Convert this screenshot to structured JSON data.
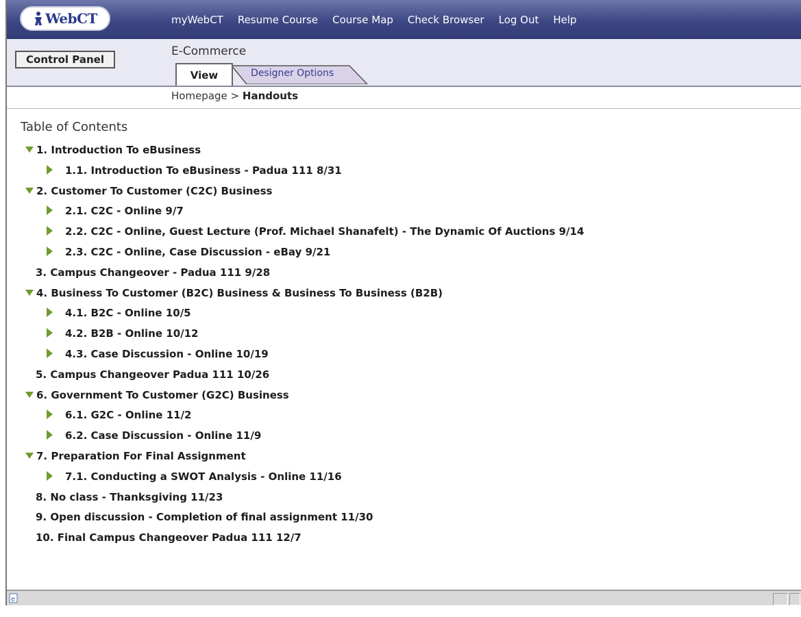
{
  "topbar": {
    "logo_text": "WebCT",
    "nav": [
      "myWebCT",
      "Resume Course",
      "Course Map",
      "Check Browser",
      "Log Out",
      "Help"
    ]
  },
  "header": {
    "control_panel": "Control Panel",
    "course_title": "E-Commerce",
    "tabs": {
      "view": "View",
      "designer": "Designer Options"
    },
    "breadcrumb": {
      "home": "Homepage",
      "separator": ">",
      "current": "Handouts"
    }
  },
  "toc": {
    "heading": "Table of Contents",
    "items": [
      {
        "level": 1,
        "expanded": true,
        "text": "1. Introduction To eBusiness"
      },
      {
        "level": 2,
        "text": "1.1. Introduction To eBusiness - Padua 111 8/31"
      },
      {
        "level": 1,
        "expanded": true,
        "text": "2. Customer To Customer (C2C) Business"
      },
      {
        "level": 2,
        "text": "2.1. C2C - Online 9/7"
      },
      {
        "level": 2,
        "text": "2.2. C2C - Online, Guest Lecture (Prof. Michael Shanafelt) - The Dynamic Of Auctions 9/14"
      },
      {
        "level": 2,
        "text": "2.3. C2C - Online, Case Discussion - eBay 9/21"
      },
      {
        "level": 1,
        "expanded": false,
        "text": "3. Campus Changeover - Padua 111 9/28"
      },
      {
        "level": 1,
        "expanded": true,
        "text": "4. Business To Customer (B2C) Business & Business To Business (B2B)"
      },
      {
        "level": 2,
        "text": "4.1. B2C - Online 10/5"
      },
      {
        "level": 2,
        "text": "4.2. B2B - Online 10/12"
      },
      {
        "level": 2,
        "text": "4.3. Case Discussion - Online 10/19"
      },
      {
        "level": 1,
        "expanded": false,
        "text": "5. Campus Changeover Padua 111 10/26"
      },
      {
        "level": 1,
        "expanded": true,
        "text": "6. Government To Customer (G2C) Business"
      },
      {
        "level": 2,
        "text": "6.1. G2C - Online 11/2"
      },
      {
        "level": 2,
        "text": "6.2. Case Discussion - Online 11/9"
      },
      {
        "level": 1,
        "expanded": true,
        "text": "7. Preparation For Final Assignment"
      },
      {
        "level": 2,
        "text": "7.1. Conducting a SWOT Analysis - Online 11/16"
      },
      {
        "level": 1,
        "expanded": false,
        "text": "8. No class - Thanksgiving 11/23"
      },
      {
        "level": 1,
        "expanded": false,
        "text": "9. Open discussion - Completion of final assignment 11/30"
      },
      {
        "level": 1,
        "expanded": false,
        "text": "10. Final Campus Changeover Padua 111 12/7"
      }
    ]
  },
  "icons": {
    "expanded": "triangle-down-icon",
    "leaf": "triangle-right-icon",
    "status": "ie-page-icon"
  },
  "colors": {
    "topbar": "#3d4783",
    "header_bg": "#e9e9f3",
    "triangle": "#6f9c2e",
    "designer_tab": "#d9d2e9"
  }
}
